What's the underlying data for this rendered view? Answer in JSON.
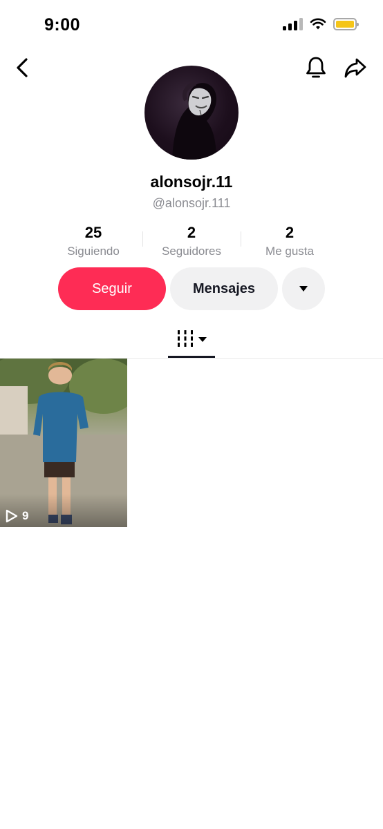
{
  "status_bar": {
    "time": "9:00",
    "battery_color": "#f5c518"
  },
  "header": {
    "back_icon": "chevron-left-icon",
    "bell_icon": "bell-icon",
    "share_icon": "share-arrow-icon"
  },
  "profile": {
    "display_name": "alonsojr.11",
    "handle": "@alonsojr.111"
  },
  "stats": [
    {
      "value": "25",
      "label": "Siguiendo"
    },
    {
      "value": "2",
      "label": "Seguidores"
    },
    {
      "value": "2",
      "label": "Me gusta"
    }
  ],
  "actions": {
    "follow_label": "Seguir",
    "message_label": "Mensajes",
    "follow_color": "#fe2c55",
    "more_icon": "caret-down-icon"
  },
  "tabs": {
    "active_icon": "grid-icon",
    "dropdown_icon": "caret-down-icon"
  },
  "videos": [
    {
      "views": "9",
      "play_icon": "play-icon"
    }
  ]
}
